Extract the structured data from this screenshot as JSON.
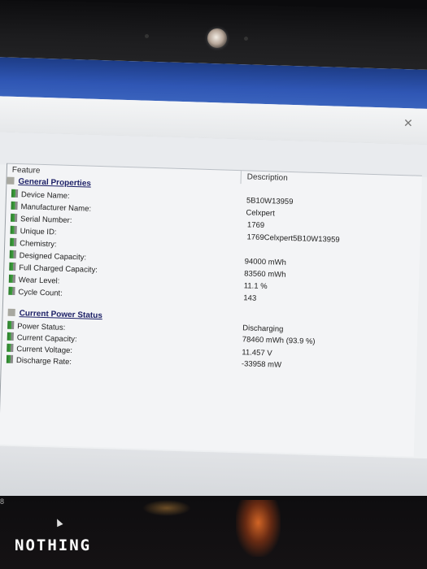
{
  "table": {
    "header_feature": "Feature",
    "header_description": "Description",
    "sections": [
      {
        "title": "General Properties",
        "rows": [
          {
            "label": "Device Name:",
            "value": "5B10W13959"
          },
          {
            "label": "Manufacturer Name:",
            "value": "Celxpert"
          },
          {
            "label": "Serial Number:",
            "value": "1769"
          },
          {
            "label": "Unique ID:",
            "value": "1769Celxpert5B10W13959"
          },
          {
            "label": "Chemistry:",
            "value": ""
          },
          {
            "label": "Designed Capacity:",
            "value": "94000 mWh"
          },
          {
            "label": "Full Charged Capacity:",
            "value": "83560 mWh"
          },
          {
            "label": "Wear Level:",
            "value": "11.1 %"
          },
          {
            "label": "Cycle Count:",
            "value": "143"
          }
        ]
      },
      {
        "title": "Current Power Status",
        "rows": [
          {
            "label": "Power Status:",
            "value": "Discharging"
          },
          {
            "label": "Current Capacity:",
            "value": "78460 mWh (93.9 %)"
          },
          {
            "label": "Current Voltage:",
            "value": "11.457 V"
          },
          {
            "label": "Discharge Rate:",
            "value": "-33958 mW"
          }
        ]
      }
    ]
  },
  "side_number": "8",
  "watermark": "NOTHING",
  "colors": {
    "section_text": "#1b1f66",
    "row_icon": "#3fa43f",
    "taskbar_blue": "#2f56b4",
    "desktop_glow": "#e66e28"
  }
}
